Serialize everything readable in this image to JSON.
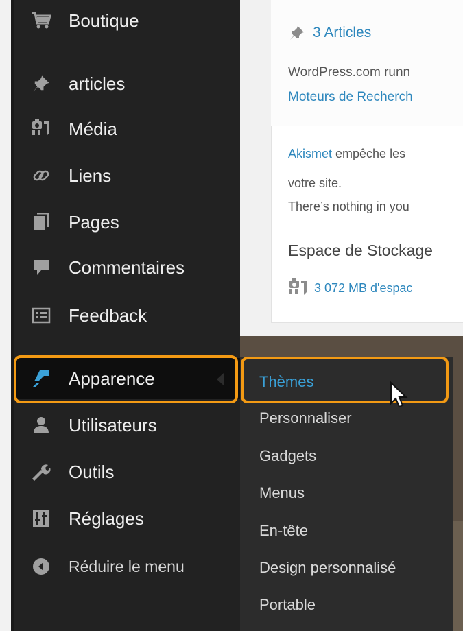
{
  "sidebar": {
    "items": [
      {
        "label": "Boutique",
        "icon": "cart-icon"
      },
      {
        "label": "articles",
        "icon": "pushpin-icon"
      },
      {
        "label": "Média",
        "icon": "media-icon"
      },
      {
        "label": "Liens",
        "icon": "link-icon"
      },
      {
        "label": "Pages",
        "icon": "pages-icon"
      },
      {
        "label": "Commentaires",
        "icon": "comment-icon"
      },
      {
        "label": "Feedback",
        "icon": "feedback-icon"
      },
      {
        "label": "Apparence",
        "icon": "paintbrush-icon",
        "active": true
      },
      {
        "label": "Utilisateurs",
        "icon": "user-icon"
      },
      {
        "label": "Outils",
        "icon": "wrench-icon"
      },
      {
        "label": "Réglages",
        "icon": "settings-icon"
      },
      {
        "label": "Réduire le menu",
        "icon": "collapse-icon"
      }
    ]
  },
  "dashboard": {
    "articles_link": "3 Articles",
    "running_text": "WordPress.com runn",
    "search_engines_link": "Moteurs de Recherch",
    "akismet_link": "Akismet",
    "akismet_text": " empêche les",
    "akismet_text2": "votre site.",
    "nothing_text": "There’s nothing in you",
    "storage_heading": "Espace de Stockage",
    "storage_link": "3 072 MB d'espac"
  },
  "submenu": {
    "items": [
      {
        "label": "Thèmes",
        "current": true
      },
      {
        "label": "Personnaliser"
      },
      {
        "label": "Gadgets"
      },
      {
        "label": "Menus"
      },
      {
        "label": "En-tête"
      },
      {
        "label": "Design personnalisé"
      },
      {
        "label": "Portable"
      }
    ]
  },
  "colors": {
    "sidebar_bg": "#222222",
    "submenu_bg": "#2c2c2c",
    "link_blue": "#2d87bd",
    "current_blue": "#3aa1d8",
    "highlight_orange": "#f39a14"
  }
}
